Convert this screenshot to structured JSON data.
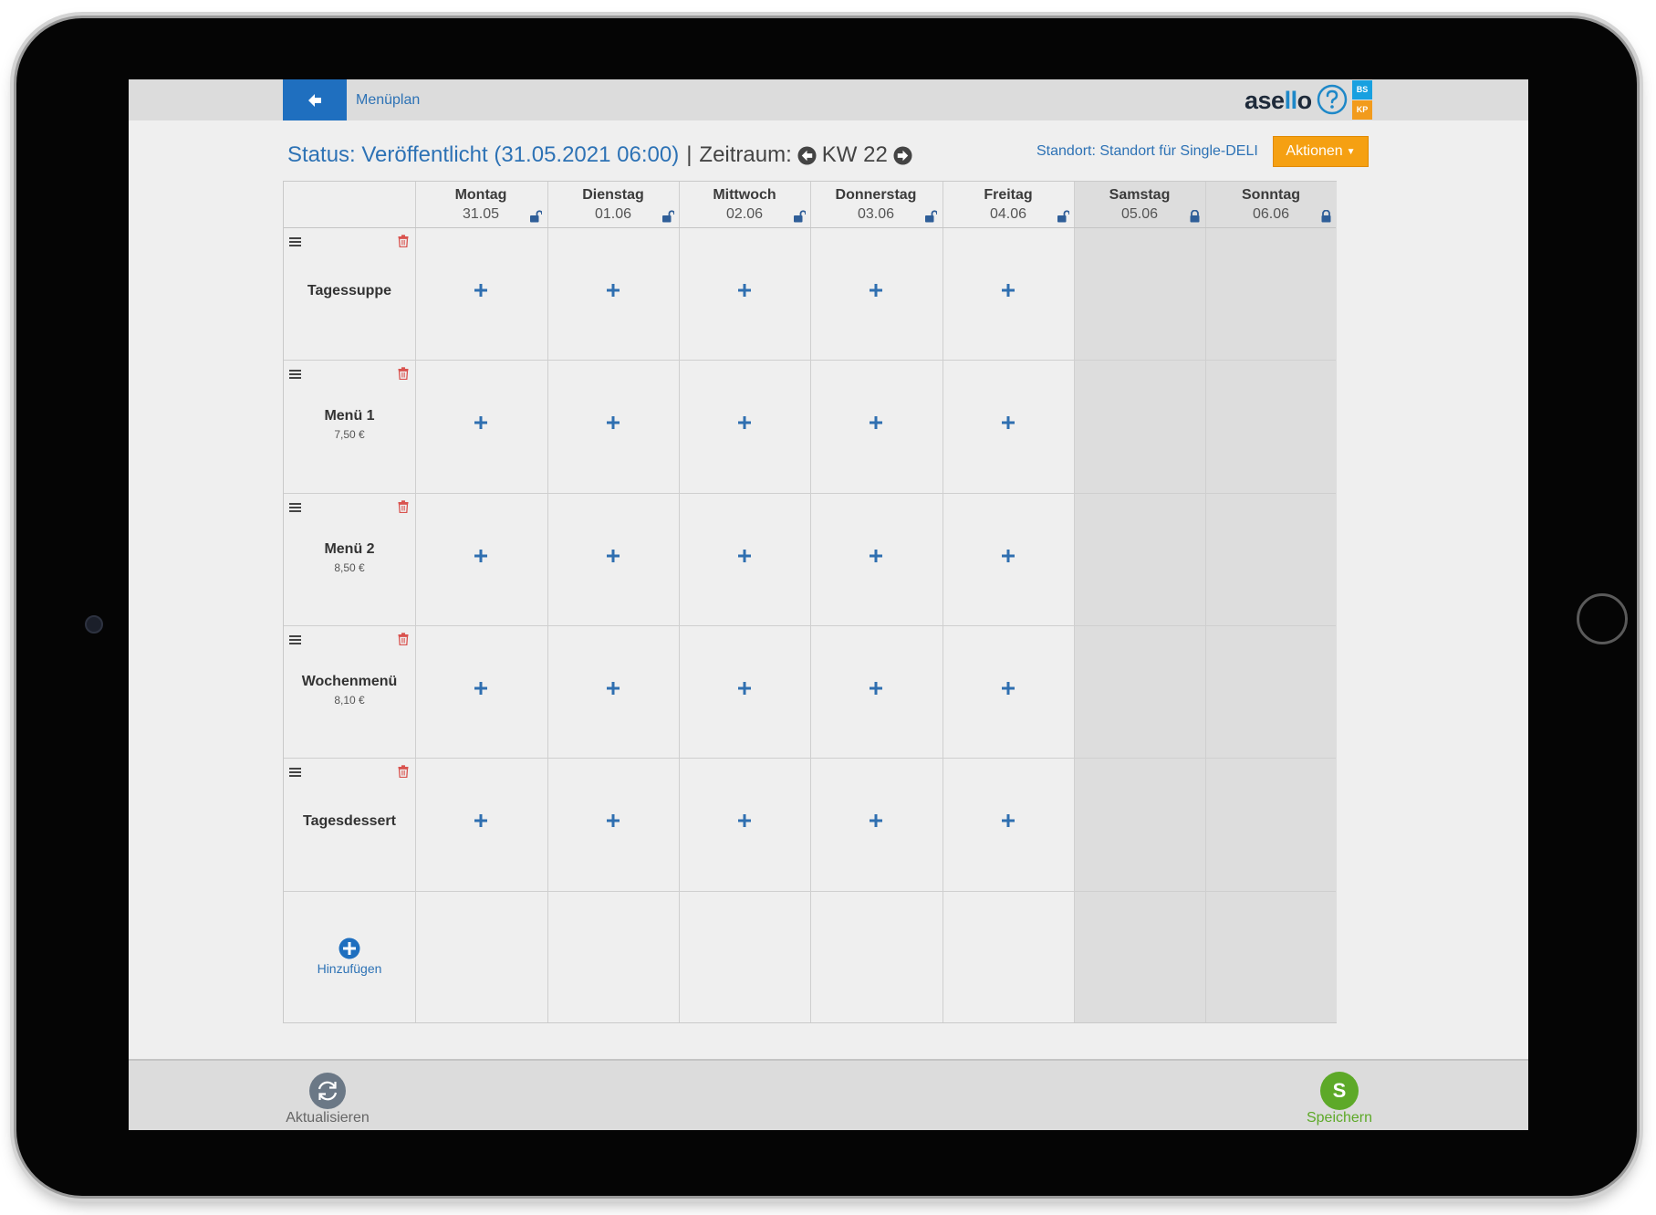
{
  "header": {
    "breadcrumb": "Menüplan",
    "brand": {
      "part1": "as",
      "part2": "e",
      "part3": "ll",
      "part4": "o"
    },
    "badge_top": "BS",
    "badge_bottom": "KP"
  },
  "status": {
    "text": "Status: Veröffentlicht (31.05.2021 06:00)",
    "separator": "|",
    "zeitraum_label": "Zeitraum:",
    "week": "KW 22",
    "standort": "Standort: Standort für Single-DELI",
    "actions_label": "Aktionen"
  },
  "days": [
    {
      "name": "Montag",
      "date": "31.05",
      "locked": false
    },
    {
      "name": "Dienstag",
      "date": "01.06",
      "locked": false
    },
    {
      "name": "Mittwoch",
      "date": "02.06",
      "locked": false
    },
    {
      "name": "Donnerstag",
      "date": "03.06",
      "locked": false
    },
    {
      "name": "Freitag",
      "date": "04.06",
      "locked": false
    },
    {
      "name": "Samstag",
      "date": "05.06",
      "locked": true
    },
    {
      "name": "Sonntag",
      "date": "06.06",
      "locked": true
    }
  ],
  "rows": [
    {
      "name": "Tagessuppe",
      "price": ""
    },
    {
      "name": "Menü 1",
      "price": "7,50 €"
    },
    {
      "name": "Menü 2",
      "price": "8,50 €"
    },
    {
      "name": "Wochenmenü",
      "price": "8,10 €"
    },
    {
      "name": "Tagesdessert",
      "price": ""
    }
  ],
  "add_row_label": "Hinzufügen",
  "footer": {
    "refresh_label": "Aktualisieren",
    "save_label": "Speichern",
    "save_icon_letter": "S"
  },
  "colors": {
    "primary_blue": "#1f6fbf",
    "link_blue": "#2d72b5",
    "actions_orange": "#f5a012",
    "save_green": "#5da928",
    "delete_red": "#d9534f",
    "weekend_gray": "#dddddd"
  }
}
